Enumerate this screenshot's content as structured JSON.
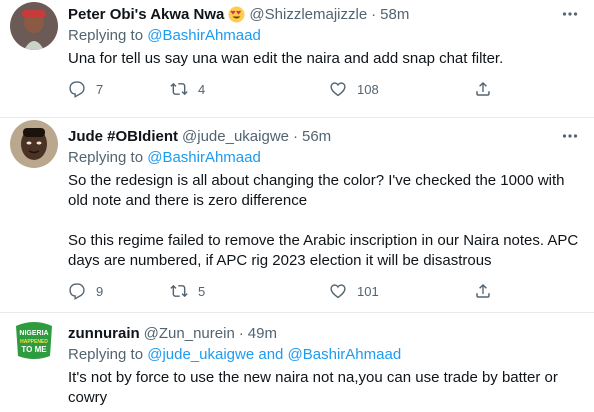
{
  "tweets": [
    {
      "name": "Peter Obi's Akwa Nwa",
      "handle": "@Shizzlemajizzle",
      "separator": "·",
      "time": "58m",
      "replying_prefix": "Replying to ",
      "replying_to": "@BashirAhmaad",
      "text": "Una for tell us say una wan edit the naira and add snap chat filter.",
      "replies": "7",
      "retweets": "4",
      "likes": "108"
    },
    {
      "name": "Jude #OBIdient",
      "handle": "@jude_ukaigwe",
      "separator": "·",
      "time": "56m",
      "replying_prefix": "Replying to ",
      "replying_to": "@BashirAhmaad",
      "text_p1": "So the redesign is all about changing the color? I've checked the 1000 with old note and there is zero difference",
      "text_p2": "So this regime failed to remove the Arabic inscription in our Naira notes. APC days are numbered, if APC rig 2023 election it will be disastrous",
      "replies": "9",
      "retweets": "5",
      "likes": "101"
    },
    {
      "name": "zunnurain",
      "handle": "@Zun_nurein",
      "separator": "·",
      "time": "49m",
      "replying_prefix": "Replying to ",
      "replying_to": "@jude_ukaigwe and @BashirAhmaad",
      "text": "It's not by force to use the new naira not na,you can use trade by batter or cowry",
      "avatar_text_1": "NIGERIA",
      "avatar_text_2": "HAPPENED",
      "avatar_text_3": "TO ME"
    }
  ],
  "colors": {
    "accent": "#1d9bf0",
    "secondary_text": "#536471",
    "primary_text": "#0f1419",
    "divider": "#e6ecf0"
  },
  "icons": {
    "reply": "reply-icon",
    "retweet": "retweet-icon",
    "like": "heart-icon",
    "share": "share-icon",
    "more": "more-icon",
    "emoji": "heart-eyes-emoji"
  }
}
